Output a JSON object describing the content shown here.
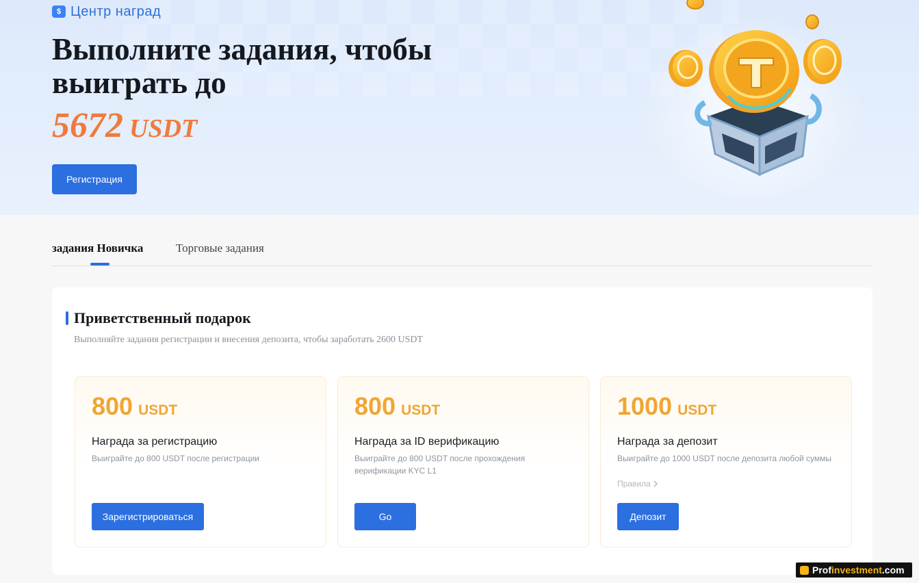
{
  "hero": {
    "center_label": "Центр наград",
    "title": "Выполните задания, чтобы выиграть до",
    "amount": "5672",
    "currency": "USDT",
    "register_button": "Регистрация",
    "gift_icon_glyph": "$",
    "art_icons": [
      "coin-icon",
      "gift-box-icon"
    ]
  },
  "tabs": [
    {
      "label": "задания Новичка",
      "active": true
    },
    {
      "label": "Торговые задания",
      "active": false
    }
  ],
  "welcome": {
    "title": "Приветственный подарок",
    "subtitle": "Выполняйте задания регистрации и внесения депозита, чтобы заработать 2600 USDT",
    "cards": [
      {
        "amount": "800",
        "unit": "USDT",
        "title": "Награда за регистрацию",
        "desc": "Выигрaйте до 800 USDT после регистрации",
        "button": "Зарегистрироваться"
      },
      {
        "amount": "800",
        "unit": "USDT",
        "title": "Награда за ID верификацию",
        "desc": "Выигрaйте до 800 USDT после прохождения верификации KYC L1",
        "button": "Go"
      },
      {
        "amount": "1000",
        "unit": "USDT",
        "title": "Награда за депозит",
        "desc": "Выигрaйте до 1000 USDT после депозита любой суммы",
        "rules": "Правила",
        "button": "Депозит"
      }
    ]
  },
  "watermark": {
    "part1": "Prof",
    "part2": "investment",
    "part3": ".com"
  },
  "colors": {
    "accent": "#2b6fe0",
    "amount_orange": "#f07a3e",
    "reward_gold": "#f0a534"
  }
}
